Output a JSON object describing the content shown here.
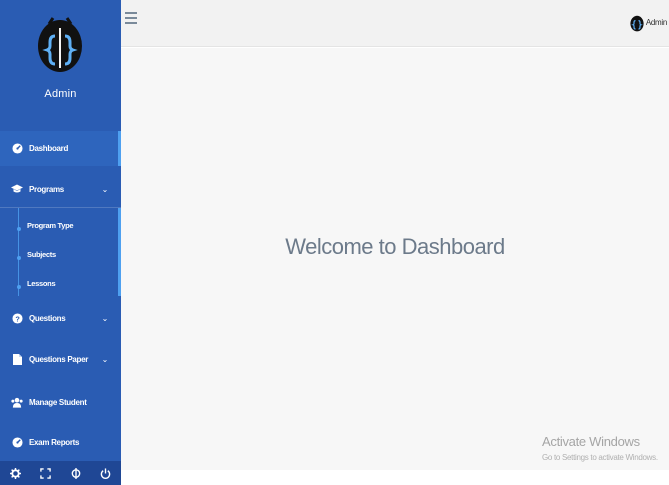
{
  "sidebar": {
    "user_name": "Admin",
    "menu": {
      "dashboard": "Dashboard",
      "programs": "Programs",
      "program_type": "Program Type",
      "subjects": "Subjects",
      "lessons": "Lessons",
      "questions": "Questions",
      "questions_paper": "Questions Paper",
      "manage_student": "Manage Student",
      "exam_reports": "Exam Reports"
    },
    "chevron": "⌄",
    "bottom_icons": [
      "settings-icon",
      "fullscreen-icon",
      "lock-icon",
      "power-icon"
    ]
  },
  "topbar": {
    "user_name": "Admin"
  },
  "main": {
    "welcome": "Welcome to Dashboard"
  },
  "watermark": {
    "title": "Activate Windows",
    "subtitle": "Go to Settings to activate Windows."
  },
  "colors": {
    "sidebar": "#2a5cb3",
    "accent": "#4ea0f0",
    "main_bg": "#f7f7f7",
    "welcome_text": "#6c7a8a"
  }
}
